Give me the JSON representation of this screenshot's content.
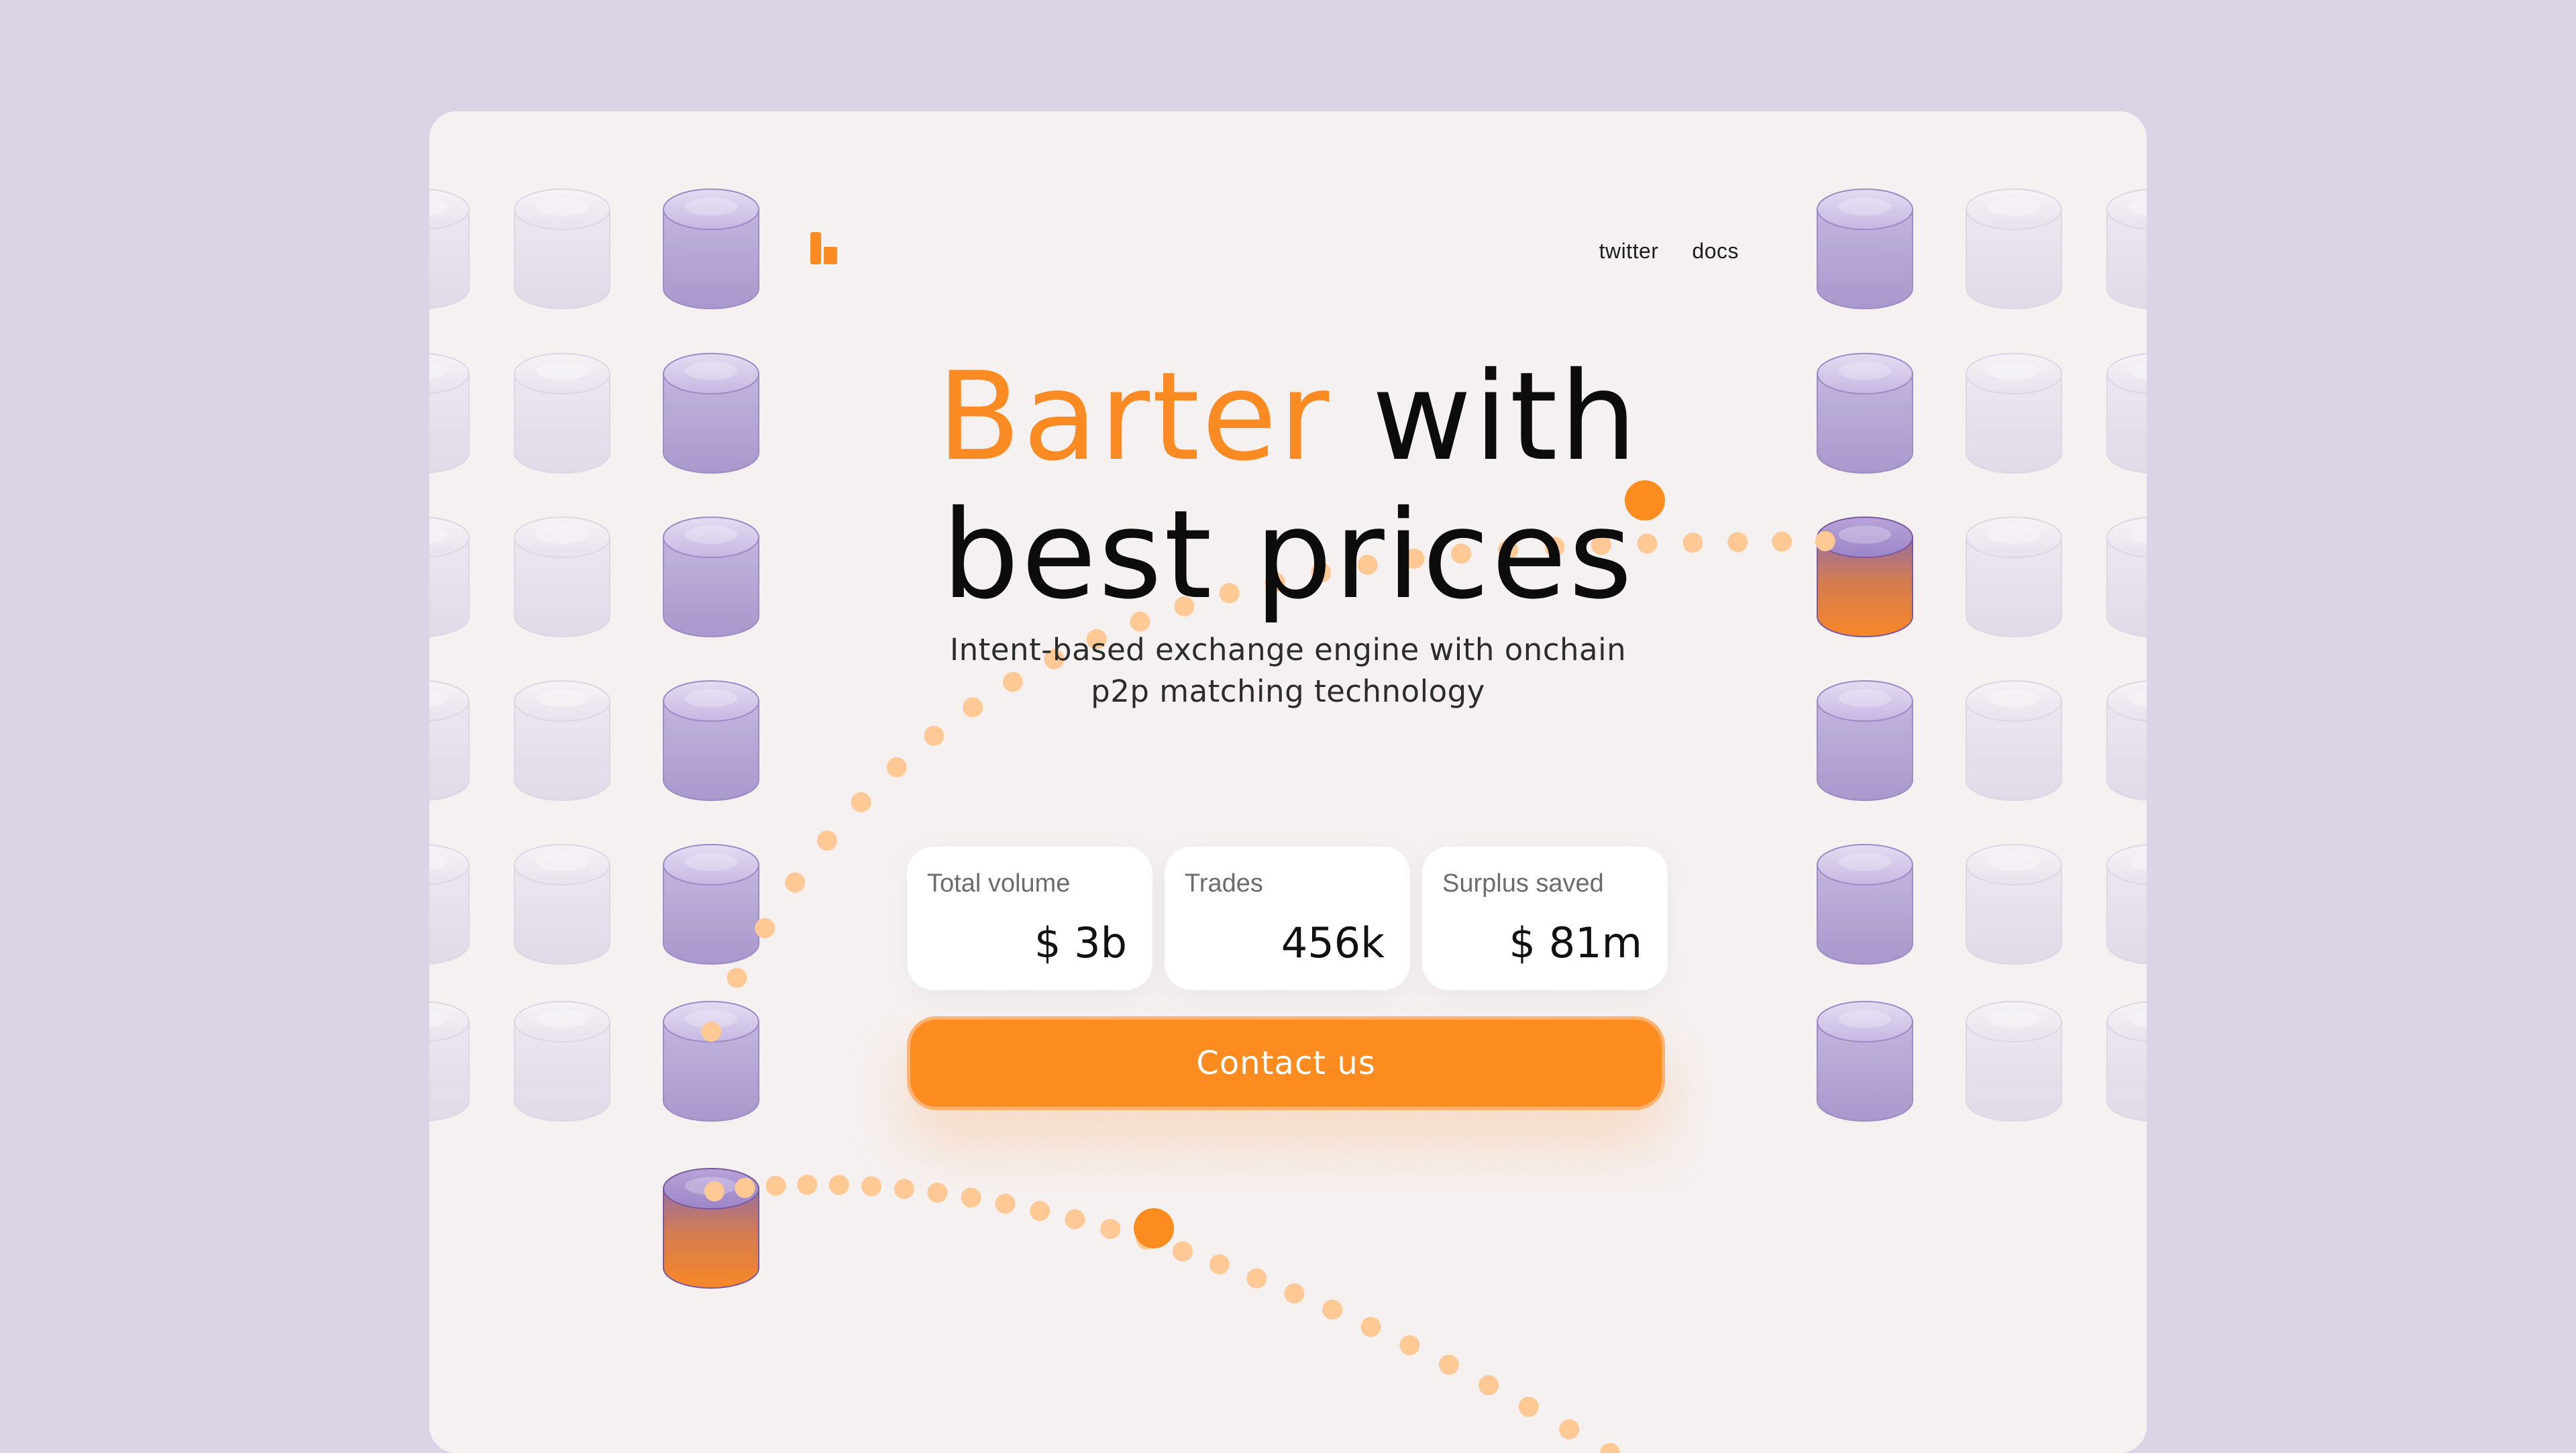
{
  "nav": {
    "twitter": "twitter",
    "docs": "docs"
  },
  "hero": {
    "title_accent": "Barter",
    "title_rest_line1": " with",
    "title_line2": "best prices",
    "subtitle_line1": "Intent-based exchange engine with onchain",
    "subtitle_line2": "p2p matching technology"
  },
  "stats": [
    {
      "label": "Total volume",
      "value": "$ 3b"
    },
    {
      "label": "Trades",
      "value": "456k"
    },
    {
      "label": "Surplus saved",
      "value": "$ 81m"
    }
  ],
  "cta": {
    "label": "Contact us"
  },
  "colors": {
    "background": "#dbd3e6",
    "card": "#f5f1f1",
    "accent": "#fd8c20",
    "purple_cylinder": "#b3a3d3",
    "faded_cylinder": "#e6e0ea",
    "dot": "#ffc996"
  },
  "icons": {
    "logo": "logo-icon",
    "cylinder": "cylinder-icon"
  }
}
